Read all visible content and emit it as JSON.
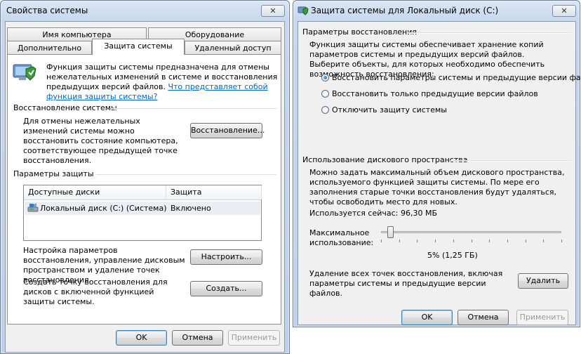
{
  "left_window": {
    "title": "Свойства системы",
    "close_label": "✕",
    "tabs_row1": [
      "Имя компьютера",
      "Оборудование"
    ],
    "tabs_row2": [
      "Дополнительно",
      "Защита системы",
      "Удаленный доступ"
    ],
    "intro_text": "Функция защиты системы предназначена для отмены нежелательных изменений в системе и восстановления предыдущих версий файлов.",
    "intro_link": "Что представляет собой функция защиты системы?",
    "restore_group": "Восстановление системы",
    "restore_text": "Для отмены нежелательных изменений системы можно восстановить состояние компьютера, соответствующее предыдущей точке восстановления.",
    "restore_button": "Восстановление...",
    "protection_group": "Параметры защиты",
    "table": {
      "headers": [
        "Доступные диски",
        "Защита"
      ],
      "rows": [
        {
          "disk": "Локальный диск (C:) (Система)",
          "status": "Включено"
        }
      ]
    },
    "configure_text": "Настройка параметров восстановления, управление дисковым пространством и удаление точек восстановления.",
    "configure_button": "Настроить...",
    "create_text": "Создать точку восстановления для дисков с включенной функцией защиты системы.",
    "create_button": "Создать...",
    "ok": "OK",
    "cancel": "Отмена",
    "apply": "Применить"
  },
  "right_window": {
    "title": "Защита системы для Локальный диск (C:)",
    "close_label": "✕",
    "restore_params_group": "Параметры восстановления",
    "restore_params_text": "Функция защиты системы обеспечивает хранение копий параметров системы и предыдущих версий файлов. Выберите объекты, для которых необходимо обеспечить возможность восстановления:",
    "radio_options": [
      {
        "label": "Восстановить параметры системы и предыдущие версии файлов",
        "checked": true
      },
      {
        "label": "Восстановить только предыдущие версии файлов",
        "checked": false
      },
      {
        "label": "Отключить защиту системы",
        "checked": false
      }
    ],
    "disk_usage_group": "Использование дискового пространства",
    "disk_usage_text": "Можно задать максимальный объем дискового пространства, используемого функцией защиты системы. По мере его заполнения старые точки восстановления будут удаляться, чтобы освободить место для новых.",
    "used_label": "Используется сейчас:",
    "used_value": "96,30 МБ",
    "max_label": "Максимальное использование:",
    "slider_percent": 5,
    "slider_value_text": "5% (1,25 ГБ)",
    "delete_text": "Удаление всех точек восстановления, включая параметры системы и предыдущие версии файлов.",
    "delete_button": "Удалить",
    "ok": "OK",
    "cancel": "Отмена",
    "apply": "Применить"
  }
}
